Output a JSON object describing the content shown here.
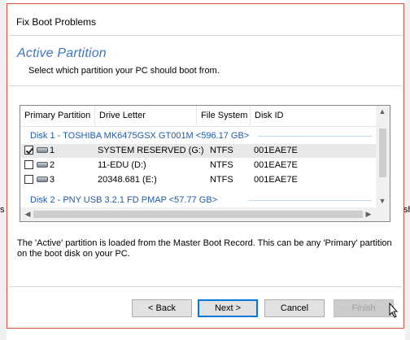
{
  "backdrop": {
    "left_text": "s",
    "right_text": "sh"
  },
  "dialog": {
    "title": "Fix Boot Problems",
    "heading": "Active Partition",
    "subheading": "Select which partition your PC should boot from.",
    "columns": [
      "Primary Partition",
      "Drive Letter",
      "File System",
      "Disk ID"
    ],
    "disks": [
      {
        "label": "Disk 1 - TOSHIBA MK6475GSX GT001M  <596.17 GB>",
        "partitions": [
          {
            "number": "1",
            "checked": true,
            "drive": "SYSTEM RESERVED (G:)",
            "fs": "NTFS",
            "id": "001EAE7E"
          },
          {
            "number": "2",
            "checked": false,
            "drive": "11-EDU (D:)",
            "fs": "NTFS",
            "id": "001EAE7E"
          },
          {
            "number": "3",
            "checked": false,
            "drive": "20348.681 (E:)",
            "fs": "NTFS",
            "id": "001EAE7E"
          }
        ]
      },
      {
        "label": "Disk 2 - PNY    USB 3.2.1 FD    PMAP  <57.77 GB>",
        "partitions": []
      }
    ],
    "description": "The 'Active' partition is loaded from the Master Boot Record. This can be any 'Primary' partition on the boot disk on your PC.",
    "buttons": {
      "back": "< Back",
      "next": "Next >",
      "cancel": "Cancel",
      "finish": "Finish"
    }
  }
}
